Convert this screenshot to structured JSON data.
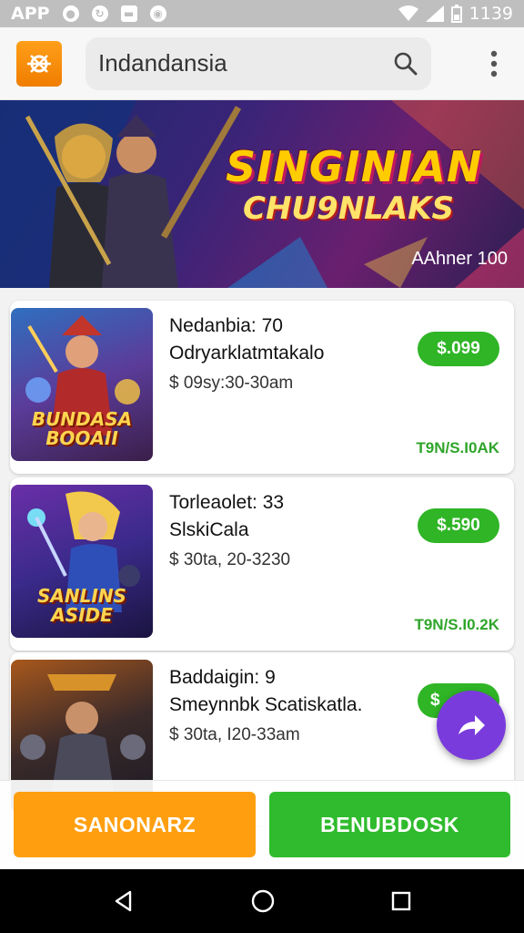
{
  "status_bar": {
    "app_label": "APP",
    "time": "1139"
  },
  "header": {
    "search_text": "Indandansia"
  },
  "banner": {
    "title_line1": "SINGINIAN",
    "title_line2": "CHU9NLAKS",
    "subtitle": "AAhner 100"
  },
  "cards": [
    {
      "title": "Nedanbia: 70",
      "subtitle": "Odryarklatmtakalo",
      "time": "$  09sy:30-30am",
      "price": "$.099",
      "tag": "T9N/S.I0AK",
      "thumb_caption": "BUNDASA BOOAII"
    },
    {
      "title": "Torleaolet: 33",
      "subtitle": "SlskiCalа",
      "time": "$  30ta, 20-3230",
      "price": "$.590",
      "tag": "T9N/S.I0.2K",
      "thumb_caption": "SANLINS ASIDE"
    },
    {
      "title": "Baddaigin: 9",
      "subtitle": "Smeynnbk Scatiskatla.",
      "time": "$  30ta, I20-33am",
      "price": "$",
      "tag": "",
      "thumb_caption": ""
    }
  ],
  "bottom_bar": {
    "left_button": "SANONARZ",
    "right_button": "BENUBDOSK"
  },
  "colors": {
    "accent_orange": "#ff9f10",
    "accent_green": "#2fbb2d",
    "fab_purple": "#7a3bdc"
  }
}
